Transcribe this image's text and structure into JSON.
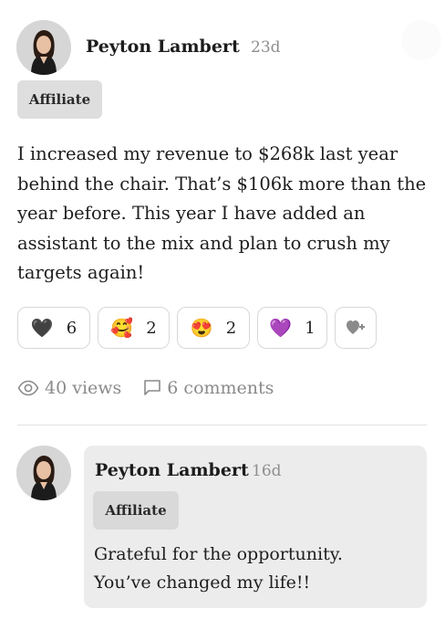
{
  "post": {
    "author": "Peyton Lambert",
    "time_ago": "23d",
    "badge": "Affiliate",
    "body": "I increased my revenue to $268k last year behind the chair. That’s $106k more than the year before. This year I have added an assistant to the mix and plan to crush my targets again!",
    "reactions": [
      {
        "emoji": "🖤",
        "count": "6",
        "icon": "black-heart-icon"
      },
      {
        "emoji": "🥰",
        "count": "2",
        "icon": "smiling-face-with-hearts-icon"
      },
      {
        "emoji": "😍",
        "count": "2",
        "icon": "heart-eyes-icon"
      },
      {
        "emoji": "💜",
        "count": "1",
        "icon": "purple-heart-icon"
      }
    ],
    "add_reaction_icon": "add-reaction-icon",
    "stats": {
      "views": "40 views",
      "comments": "6 comments"
    }
  },
  "comment": {
    "author": "Peyton Lambert",
    "time_ago": "16d",
    "badge": "Affiliate",
    "line1": "Grateful for the opportunity.",
    "line2": "You’ve changed my life!!"
  },
  "colors": {
    "badge_bg": "#dedede",
    "comment_bg": "#ececec",
    "muted_text": "#8f8f8f"
  }
}
